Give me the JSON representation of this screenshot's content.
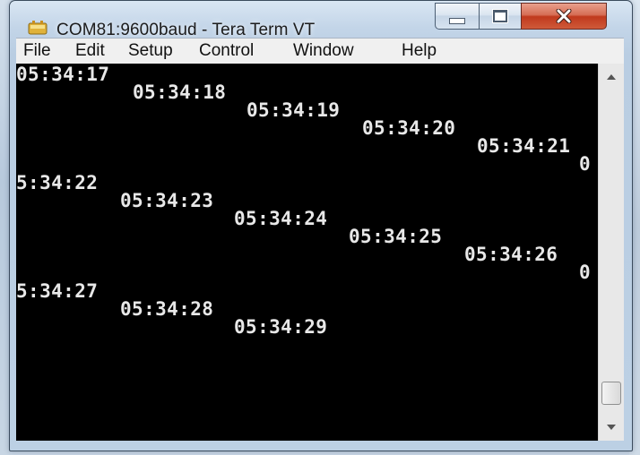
{
  "window": {
    "title": "COM81:9600baud - Tera Term VT",
    "controls": {
      "minimize": "minimize",
      "maximize": "maximize",
      "close": "close"
    }
  },
  "menu": [
    "File",
    "Edit",
    "Setup",
    "Control",
    "Window",
    "Help"
  ],
  "terminal": {
    "background": "#000000",
    "text_color": "#e8e8e8",
    "lines": [
      "05:34:17",
      "05:34:18",
      "05:34:19",
      "05:34:20",
      "05:34:21",
      "0",
      "5:34:22",
      "05:34:23",
      "05:34:24",
      "05:34:25",
      "05:34:26",
      "0",
      "5:34:27",
      "05:34:28",
      "05:34:29"
    ]
  },
  "colors": {
    "close_button": "#c0391d",
    "titlebar": "#c3d5e8",
    "menubar": "#f0f0f0"
  }
}
